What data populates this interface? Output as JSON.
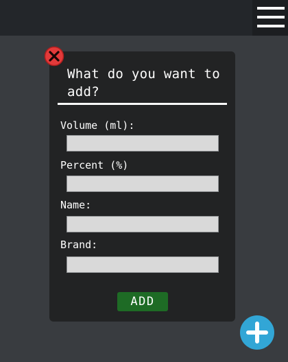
{
  "header": {
    "menu_icon": "hamburger-menu-icon"
  },
  "modal": {
    "title": "What do you want to add?",
    "close_icon": "close-circle-icon",
    "fields": [
      {
        "label": "Volume (ml):",
        "value": "",
        "placeholder": ""
      },
      {
        "label": "Percent (%)",
        "value": "",
        "placeholder": ""
      },
      {
        "label": "Name:",
        "value": "",
        "placeholder": ""
      },
      {
        "label": "Brand:",
        "value": "",
        "placeholder": ""
      }
    ],
    "add_label": "ADD"
  },
  "fab": {
    "icon": "plus-icon"
  },
  "colors": {
    "background": "#393c40",
    "topbar": "#23262a",
    "modal": "#222324",
    "add_button": "#1e6b25",
    "fab": "#32a6d6",
    "close": "#e23a3a"
  }
}
